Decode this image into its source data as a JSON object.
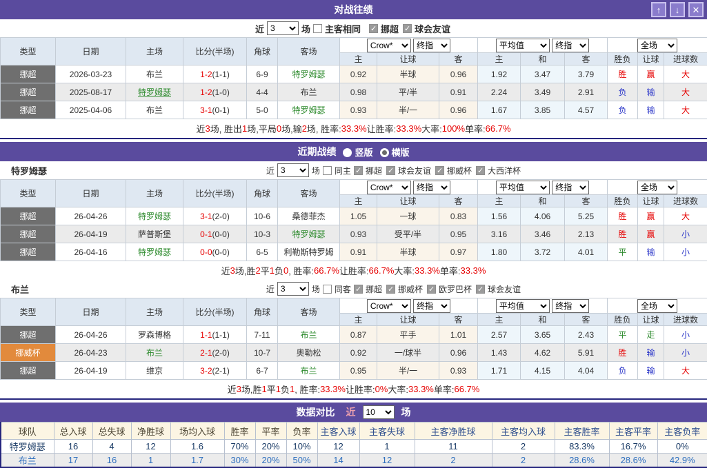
{
  "colors": {
    "header_purple": "#5a4b9e",
    "navy_border": "#26267e",
    "win_red": "#e60000",
    "loss_blue": "#2a35c8",
    "draw_green": "#2e8b2e",
    "team_green": "#2e8b2e",
    "cup_orange": "#e28a3c",
    "league_gray": "#6f6f6f",
    "compare_blue": "#2e6fbe"
  },
  "icons": {
    "up": "↑",
    "down": "↓",
    "close": "✕"
  },
  "columns": {
    "type": "类型",
    "date": "日期",
    "home": "主场",
    "score": "比分(半场)",
    "corner": "角球",
    "away": "客场",
    "h": "主",
    "handicap": "让球",
    "a": "客",
    "avg_h": "主",
    "draw": "和",
    "avg_a": "客",
    "wl": "胜负",
    "let": "让球",
    "goals": "进球数"
  },
  "selects": {
    "crow": "Crow*",
    "final1": "终指",
    "avg": "平均值",
    "final2": "终指",
    "scope": "全场"
  },
  "h2h": {
    "title": "对战往绩",
    "filter": {
      "near": "近",
      "games": "3",
      "chang": "场",
      "same": "主客相同",
      "same_checked": false,
      "leagues_checked": true,
      "leagues": [
        "挪超",
        "球会友谊"
      ]
    },
    "rows": [
      {
        "type": "挪超",
        "type_c": "gray",
        "date": "2026-03-23",
        "home": "布兰",
        "home_c": "k",
        "score": "1-2",
        "half": "(1-1)",
        "corner": "6-9",
        "away": "特罗姆瑟",
        "away_c": "g",
        "o1": "0.92",
        "o2": "半球",
        "o3": "0.96",
        "a1": "1.92",
        "a2": "3.47",
        "a3": "3.79",
        "r1": "胜",
        "r1c": "r",
        "r2": "赢",
        "r2c": "r",
        "r3": "大",
        "r3c": "r"
      },
      {
        "type": "挪超",
        "type_c": "gray",
        "date": "2025-08-17",
        "home": "特罗姆瑟",
        "home_c": "gu",
        "score": "1-2",
        "half": "(1-0)",
        "corner": "4-4",
        "away": "布兰",
        "away_c": "k",
        "o1": "0.98",
        "o2": "平/半",
        "o3": "0.91",
        "a1": "2.24",
        "a2": "3.49",
        "a3": "2.91",
        "r1": "负",
        "r1c": "b",
        "r2": "输",
        "r2c": "b",
        "r3": "大",
        "r3c": "r"
      },
      {
        "type": "挪超",
        "type_c": "gray",
        "date": "2025-04-06",
        "home": "布兰",
        "home_c": "k",
        "score": "3-1",
        "half": "(0-1)",
        "corner": "5-0",
        "away": "特罗姆瑟",
        "away_c": "g",
        "o1": "0.93",
        "o2": "半/一",
        "o3": "0.96",
        "a1": "1.67",
        "a2": "3.85",
        "a3": "4.57",
        "r1": "负",
        "r1c": "b",
        "r2": "输",
        "r2c": "b",
        "r3": "大",
        "r3c": "r"
      }
    ],
    "summary": [
      "近 ",
      "3",
      " 场, 胜出 ",
      "1",
      " 场,平局 ",
      "0",
      " 场,输 ",
      "2",
      " 场, 胜率: ",
      "33.3%",
      " 让胜率: ",
      "33.3%",
      " 大率: ",
      "100%",
      " 单率: ",
      "66.7%"
    ]
  },
  "recent": {
    "title": "近期战绩",
    "radios": [
      {
        "label": "竖版",
        "state": "off"
      },
      {
        "label": "横版",
        "state": "on"
      }
    ],
    "teams": [
      {
        "name": "特罗姆瑟",
        "filter": {
          "near": "近",
          "games": "3",
          "chang": "场",
          "same": "同主",
          "same_checked": false,
          "leagues_checked": true,
          "leagues": [
            "挪超",
            "球会友谊",
            "挪威杯",
            "大西洋杯"
          ]
        },
        "rows": [
          {
            "type": "挪超",
            "type_c": "gray",
            "date": "26-04-26",
            "home": "特罗姆瑟",
            "home_c": "g",
            "score": "3-1",
            "half": "(2-0)",
            "corner": "10-6",
            "away": "桑德菲杰",
            "away_c": "k",
            "o1": "1.05",
            "o2": "一球",
            "o3": "0.83",
            "a1": "1.56",
            "a2": "4.06",
            "a3": "5.25",
            "r1": "胜",
            "r1c": "r",
            "r2": "赢",
            "r2c": "r",
            "r3": "大",
            "r3c": "r"
          },
          {
            "type": "挪超",
            "type_c": "gray",
            "date": "26-04-19",
            "home": "萨普斯堡",
            "home_c": "k",
            "score": "0-1",
            "half": "(0-0)",
            "corner": "10-3",
            "away": "特罗姆瑟",
            "away_c": "g",
            "o1": "0.93",
            "o2": "受平/半",
            "o3": "0.95",
            "a1": "3.16",
            "a2": "3.46",
            "a3": "2.13",
            "r1": "胜",
            "r1c": "r",
            "r2": "赢",
            "r2c": "r",
            "r3": "小",
            "r3c": "b"
          },
          {
            "type": "挪超",
            "type_c": "gray",
            "date": "26-04-16",
            "home": "特罗姆瑟",
            "home_c": "g",
            "score": "0-0",
            "half": "(0-0)",
            "corner": "6-5",
            "away": "利勒斯特罗姆",
            "away_c": "k",
            "o1": "0.91",
            "o2": "半球",
            "o3": "0.97",
            "a1": "1.80",
            "a2": "3.72",
            "a3": "4.01",
            "r1": "平",
            "r1c": "g",
            "r2": "输",
            "r2c": "b",
            "r3": "小",
            "r3c": "b"
          }
        ],
        "summary": [
          "近",
          "3",
          "场,胜",
          "2",
          "平",
          "1",
          "负",
          "0",
          ", 胜率:",
          "66.7%",
          " 让胜率:",
          "66.7%",
          " 大率:",
          "33.3%",
          " 单率:",
          "33.3%"
        ]
      },
      {
        "name": "布兰",
        "filter": {
          "near": "近",
          "games": "3",
          "chang": "场",
          "same": "同客",
          "same_checked": false,
          "leagues_checked": true,
          "leagues": [
            "挪超",
            "挪威杯",
            "欧罗巴杯",
            "球会友谊"
          ]
        },
        "rows": [
          {
            "type": "挪超",
            "type_c": "gray",
            "date": "26-04-26",
            "home": "罗森博格",
            "home_c": "k",
            "score": "1-1",
            "half": "(1-1)",
            "corner": "7-11",
            "away": "布兰",
            "away_c": "g",
            "o1": "0.87",
            "o2": "平手",
            "o3": "1.01",
            "a1": "2.57",
            "a2": "3.65",
            "a3": "2.43",
            "r1": "平",
            "r1c": "g",
            "r2": "走",
            "r2c": "g",
            "r3": "小",
            "r3c": "b"
          },
          {
            "type": "挪威杯",
            "type_c": "orange",
            "date": "26-04-23",
            "home": "布兰",
            "home_c": "g",
            "score": "2-1",
            "half": "(2-0)",
            "corner": "10-7",
            "away": "奥勒松",
            "away_c": "k",
            "o1": "0.92",
            "o2": "一/球半",
            "o3": "0.96",
            "a1": "1.43",
            "a2": "4.62",
            "a3": "5.91",
            "r1": "胜",
            "r1c": "r",
            "r2": "输",
            "r2c": "b",
            "r3": "小",
            "r3c": "b"
          },
          {
            "type": "挪超",
            "type_c": "gray",
            "date": "26-04-19",
            "home": "维京",
            "home_c": "k",
            "score": "3-2",
            "half": "(2-1)",
            "corner": "6-7",
            "away": "布兰",
            "away_c": "g",
            "o1": "0.95",
            "o2": "半/一",
            "o3": "0.93",
            "a1": "1.71",
            "a2": "4.15",
            "a3": "4.04",
            "r1": "负",
            "r1c": "b",
            "r2": "输",
            "r2c": "b",
            "r3": "大",
            "r3c": "r"
          }
        ],
        "summary": [
          "近",
          "3",
          "场,胜",
          "1",
          "平",
          "1",
          "负",
          "1",
          ", 胜率:",
          "33.3%",
          " 让胜率:",
          "0%",
          " 大率:",
          "33.3%",
          " 单率:",
          "66.7%"
        ]
      }
    ]
  },
  "compare": {
    "title": "数据对比",
    "near": "近",
    "games": "10",
    "chang": "场",
    "headers": [
      "球队",
      "总入球",
      "总失球",
      "净胜球",
      "场均入球",
      "胜率",
      "平率",
      "负率",
      "主客入球",
      "主客失球",
      "主客净胜球",
      "主客均入球",
      "主客胜率",
      "主客平率",
      "主客负率"
    ],
    "rows": [
      {
        "team": "特罗姆瑟",
        "values": [
          "16",
          "4",
          "12",
          "1.6",
          "70%",
          "20%",
          "10%",
          "12",
          "1",
          "11",
          "2",
          "83.3%",
          "16.7%",
          "0%"
        ]
      },
      {
        "team": "布兰",
        "values": [
          "17",
          "16",
          "1",
          "1.7",
          "30%",
          "20%",
          "50%",
          "14",
          "12",
          "2",
          "2",
          "28.6%",
          "28.6%",
          "42.9%"
        ]
      }
    ]
  }
}
